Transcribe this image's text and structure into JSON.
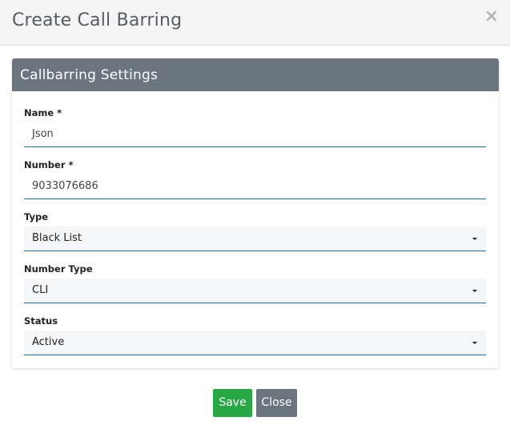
{
  "modal": {
    "title": "Create Call Barring",
    "close_glyph": "×"
  },
  "card": {
    "title": "Callbarring Settings"
  },
  "form": {
    "name": {
      "label": "Name *",
      "value": "Json"
    },
    "number": {
      "label": "Number *",
      "value": "9033076686"
    },
    "type": {
      "label": "Type",
      "value": "Black List"
    },
    "number_type": {
      "label": "Number Type",
      "value": "CLI"
    },
    "status": {
      "label": "Status",
      "value": "Active"
    }
  },
  "footer": {
    "save_label": "Save",
    "close_label": "Close"
  },
  "colors": {
    "header_bg": "#f5f5f5",
    "card_header_bg": "#6c757d",
    "underline": "#1f6f9b",
    "save_button": "#28a745",
    "close_button": "#6c757d"
  },
  "icons": {
    "close": "close-icon",
    "dropdown": "chevron-down-icon"
  }
}
